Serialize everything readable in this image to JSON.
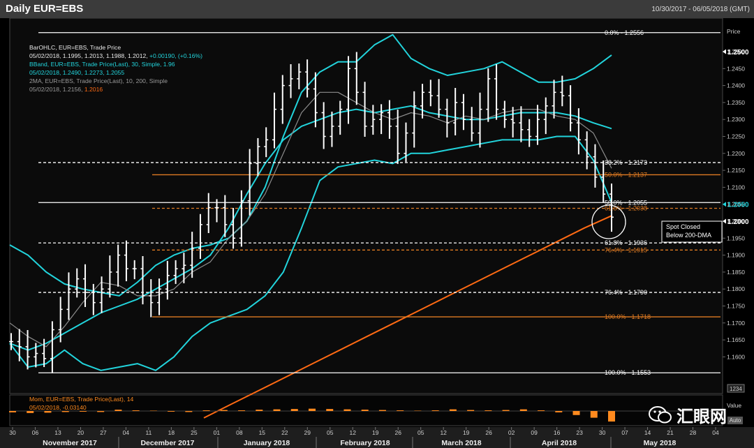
{
  "window": {
    "title": "Daily EUR=EBS",
    "date_range": "10/30/2017 - 06/05/2018 (GMT)",
    "price_axis_label": "Price",
    "value_axis_label": "Value",
    "auto_label": "Auto",
    "last_value_box": "1234"
  },
  "legend": {
    "ohlc_name": "BarOHLC, EUR=EBS, Trade Price",
    "ohlc_values": "05/02/2018, 1.1995, 1.2013, 1.1988, 1.2012,",
    "ohlc_change": "+0.00190, (+0.16%)",
    "bband_name": "BBand, EUR=EBS, Trade Price(Last),  30, Simple, 1.96",
    "bband_values": "05/02/2018, 1.2490, 1.2273, 1.2055",
    "ma_name": "2MA, EUR=EBS, Trade Price(Last),  10, 200, Simple",
    "ma_values_date": "05/02/2018, 1.2156,",
    "ma_values_200": "1.2016",
    "mom_name": "Mom, EUR=EBS, Trade Price(Last),  14",
    "mom_values": "05/02/2018, -0.03140"
  },
  "annotation": {
    "line1": "Spot Closed",
    "line2": "Below 200-DMA"
  },
  "watermark": {
    "text": "汇眼网"
  },
  "colors": {
    "price": "#ffffff",
    "bband": "#22d4dc",
    "ma10": "#8c8c8c",
    "ma200": "#ff6a13",
    "fib_orange": "#e07b22",
    "momentum": "#ff8a1e",
    "background": "#000000"
  },
  "chart_data": {
    "type": "line",
    "instrument": "EUR=EBS",
    "y_axis": {
      "min": 1.155,
      "max": 1.255,
      "ticks": [
        "1.1600",
        "1.1650",
        "1.1700",
        "1.1750",
        "1.1800",
        "1.1850",
        "1.1900",
        "1.1950",
        "1.2000",
        "1.2050",
        "1.2100",
        "1.2150",
        "1.2200",
        "1.2250",
        "1.2300",
        "1.2350",
        "1.2400",
        "1.2450",
        "1.2500"
      ],
      "label": "Price"
    },
    "x_axis": {
      "days": [
        "30",
        "06",
        "13",
        "20",
        "27",
        "04",
        "11",
        "18",
        "25",
        "01",
        "08",
        "15",
        "22",
        "29",
        "05",
        "12",
        "19",
        "26",
        "05",
        "12",
        "19",
        "26",
        "02",
        "09",
        "16",
        "23",
        "30",
        "07",
        "14",
        "21",
        "28",
        "04"
      ],
      "months": [
        "November 2017",
        "December 2017",
        "January 2018",
        "February 2018",
        "March 2018",
        "April 2018",
        "May 2018"
      ]
    },
    "series": [
      {
        "name": "BarOHLC close",
        "values": [
          1.1645,
          1.163,
          1.16,
          1.161,
          1.1595,
          1.168,
          1.174,
          1.18,
          1.183,
          1.179,
          1.176,
          1.18,
          1.185,
          1.19,
          1.186,
          1.186,
          1.178,
          1.176,
          1.18,
          1.184,
          1.186,
          1.187,
          1.192,
          1.199,
          1.204,
          1.204,
          1.199,
          1.195,
          1.206,
          1.217,
          1.222,
          1.224,
          1.233,
          1.24,
          1.242,
          1.244,
          1.239,
          1.232,
          1.225,
          1.228,
          1.233,
          1.245,
          1.238,
          1.228,
          1.23,
          1.232,
          1.228,
          1.22,
          1.226,
          1.234,
          1.238,
          1.237,
          1.233,
          1.229,
          1.235,
          1.23,
          1.226,
          1.233,
          1.242,
          1.233,
          1.23,
          1.229,
          1.227,
          1.225,
          1.23,
          1.234,
          1.238,
          1.237,
          1.229,
          1.224,
          1.219,
          1.213,
          1.208,
          1.2012
        ]
      },
      {
        "name": "BBand upper",
        "values": [
          1.193,
          1.19,
          1.185,
          1.1815,
          1.18,
          1.179,
          1.178,
          1.182,
          1.187,
          1.19,
          1.192,
          1.193,
          1.195,
          1.2,
          1.21,
          1.225,
          1.238,
          1.244,
          1.247,
          1.247,
          1.252,
          1.255,
          1.248,
          1.245,
          1.243,
          1.244,
          1.245,
          1.247,
          1.244,
          1.241,
          1.241,
          1.242,
          1.245,
          1.249
        ]
      },
      {
        "name": "BBand middle",
        "values": [
          1.164,
          1.162,
          1.164,
          1.167,
          1.17,
          1.173,
          1.175,
          1.177,
          1.18,
          1.183,
          1.186,
          1.19,
          1.198,
          1.208,
          1.217,
          1.224,
          1.228,
          1.23,
          1.232,
          1.233,
          1.232,
          1.233,
          1.234,
          1.232,
          1.231,
          1.23,
          1.23,
          1.231,
          1.232,
          1.232,
          1.232,
          1.231,
          1.229,
          1.2273
        ]
      },
      {
        "name": "BBand lower",
        "values": [
          1.164,
          1.157,
          1.158,
          1.162,
          1.158,
          1.156,
          1.157,
          1.158,
          1.156,
          1.16,
          1.166,
          1.17,
          1.172,
          1.174,
          1.178,
          1.185,
          1.198,
          1.212,
          1.216,
          1.217,
          1.218,
          1.217,
          1.22,
          1.22,
          1.221,
          1.222,
          1.223,
          1.224,
          1.224,
          1.224,
          1.225,
          1.225,
          1.218,
          1.2055
        ]
      },
      {
        "name": "10-DMA",
        "values": [
          1.17,
          1.166,
          1.163,
          1.169,
          1.176,
          1.182,
          1.181,
          1.178,
          1.178,
          1.18,
          1.185,
          1.188,
          1.195,
          1.2,
          1.208,
          1.22,
          1.232,
          1.238,
          1.238,
          1.235,
          1.232,
          1.23,
          1.232,
          1.231,
          1.229,
          1.231,
          1.23,
          1.232,
          1.233,
          1.233,
          1.231,
          1.23,
          1.226,
          1.2156
        ]
      },
      {
        "name": "200-DMA",
        "values": [
          1.142,
          1.146,
          1.15,
          1.154,
          1.158,
          1.162,
          1.166,
          1.17,
          1.174,
          1.178,
          1.182,
          1.186,
          1.19,
          1.194,
          1.198,
          1.2016
        ]
      }
    ],
    "fib_levels_white": [
      {
        "label": "0.0%",
        "value": 1.2556
      },
      {
        "label": "38.2%",
        "value": 1.2173
      },
      {
        "label": "50.0%",
        "value": 1.2055
      },
      {
        "label": "61.8%",
        "value": 1.1936
      },
      {
        "label": "76.4%",
        "value": 1.179
      },
      {
        "label": "100.0%",
        "value": 1.1553
      }
    ],
    "fib_levels_orange": [
      {
        "label": "50.0%",
        "value": 1.2137
      },
      {
        "label": "61.8%",
        "value": 1.2038
      },
      {
        "label": "76.4%",
        "value": 1.1915
      },
      {
        "label": "100.0%",
        "value": 1.1718
      }
    ],
    "price_markers": [
      {
        "value": "1.2500",
        "color": "#ffffff"
      },
      {
        "value": "1.2050",
        "color": "#22d4dc"
      },
      {
        "value": "1.2000",
        "color": "#ffffff"
      }
    ],
    "momentum": {
      "name": "Mom",
      "values": [
        -0.004,
        -0.006,
        -0.005,
        -0.003,
        -0.002,
        -0.003,
        0.004,
        0.002,
        0.001,
        -0.002,
        -0.003,
        0.002,
        0.003,
        0.002,
        0.004,
        0.005,
        0.006,
        0.007,
        0.006,
        0.005,
        0.004,
        0.003,
        0.002,
        0.001,
        0.002,
        0.005,
        0.003,
        0.002,
        0.003,
        0.005,
        0.002,
        -0.004,
        -0.012,
        -0.02,
        -0.0314
      ]
    }
  }
}
